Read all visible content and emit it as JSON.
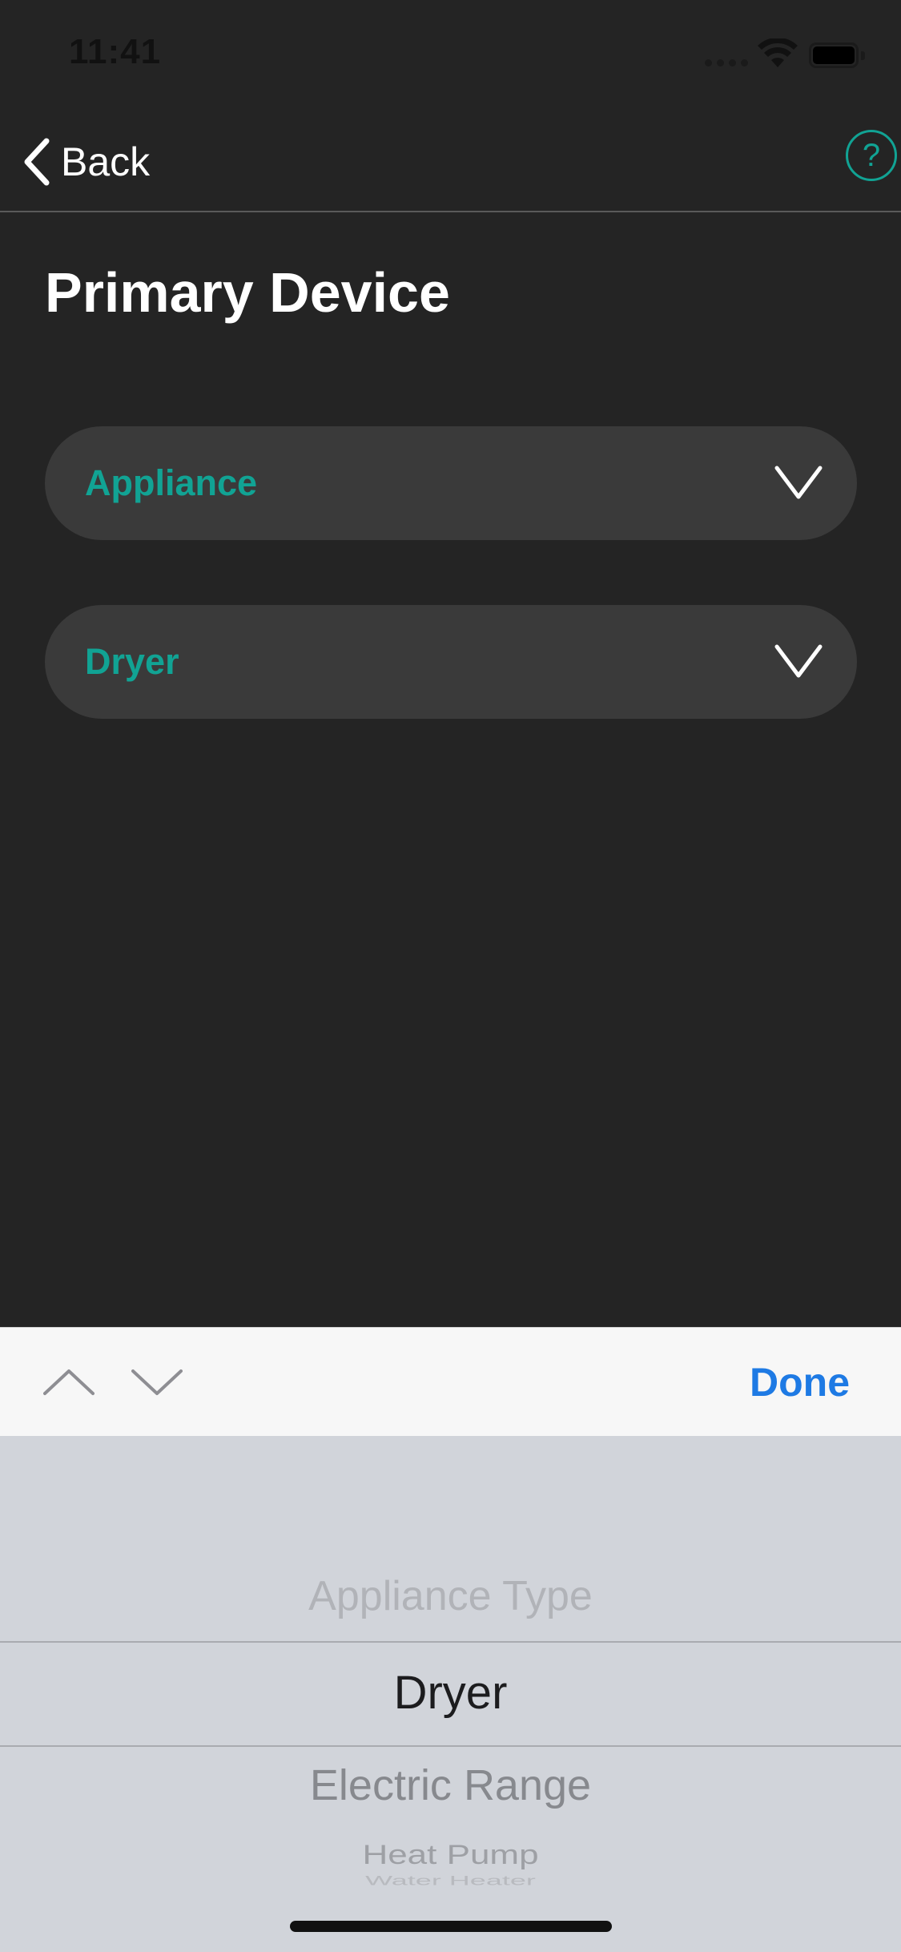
{
  "status_bar": {
    "time": "11:41"
  },
  "nav": {
    "back_label": "Back",
    "help_label": "?"
  },
  "page": {
    "title": "Primary Device"
  },
  "dropdowns": [
    {
      "value": "Appliance"
    },
    {
      "value": "Dryer"
    }
  ],
  "toolbar": {
    "done_label": "Done"
  },
  "picker": {
    "items": [
      "Appliance Type",
      "Dryer",
      "Electric Range",
      "Heat Pump",
      "Water Heater"
    ],
    "selected": "Dryer"
  },
  "colors": {
    "accent": "#11a394",
    "background": "#242424",
    "field": "#3a3a3a",
    "done": "#1e7ae4"
  }
}
